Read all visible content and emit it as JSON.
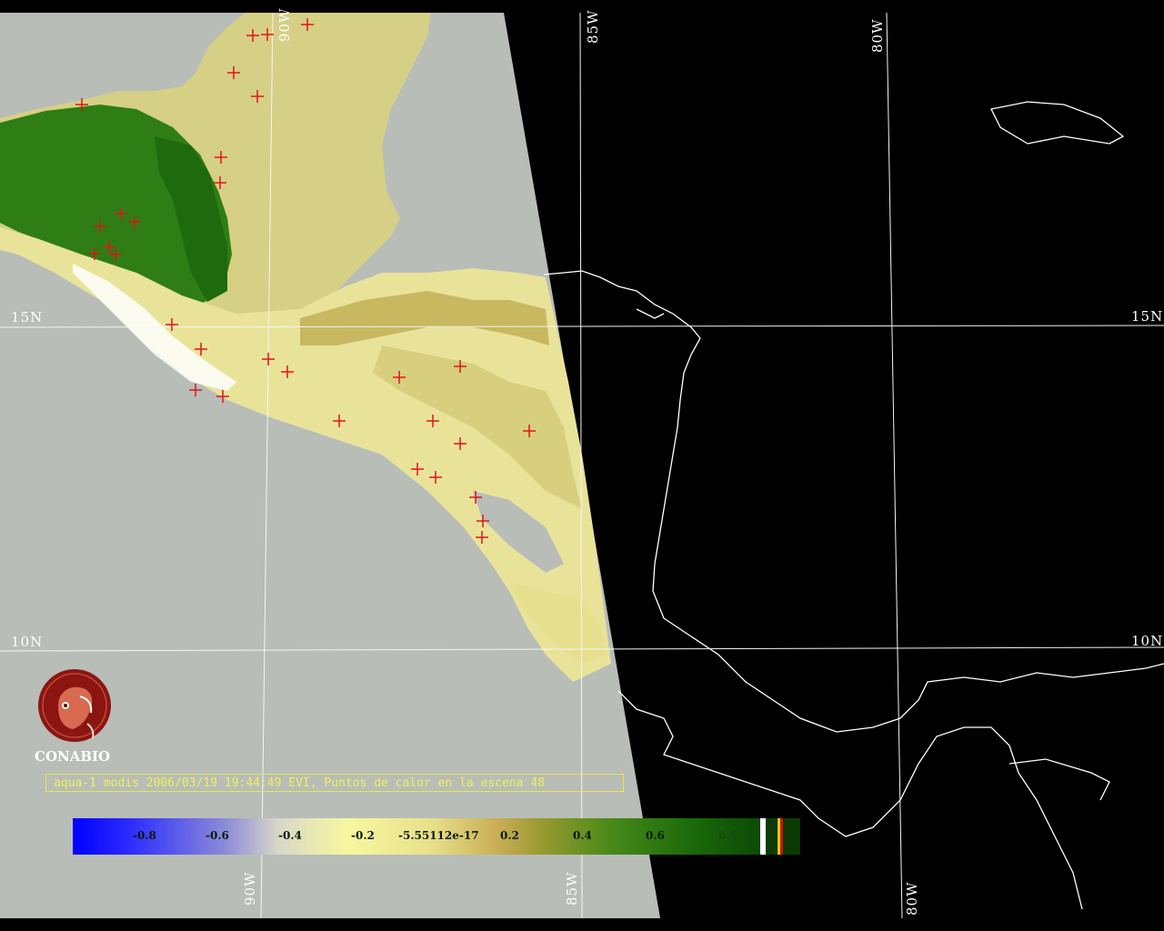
{
  "map": {
    "grid_labels": {
      "lat_15_left": "15N",
      "lat_15_right": "15N",
      "lat_10_left": "10N",
      "lat_10_right": "10N",
      "lon_90_top": "90W",
      "lon_85_top": "85W",
      "lon_80_top": "80W",
      "lon_90_bottom": "90W",
      "lon_85_bottom": "85W",
      "lon_80_bottom": "80W"
    },
    "hotspot_color": "#e0141a",
    "swath_background": "#b8bdb8",
    "vegetation_dense_color": "#2a7a12",
    "vegetation_sparse_color": "#e9e39a",
    "water_edge_color": "#6a78d8",
    "coastline_color": "#ffffff"
  },
  "logo": {
    "name": "CONABIO",
    "icon": "conabio-macaw-logo-icon",
    "color": "#8c1512"
  },
  "caption": {
    "text": "aqua-1 modis 2006/03/19 19:44:49 EVI, Puntos de calor en la escena 48",
    "color": "#f0f05a"
  },
  "colorbar": {
    "ticks": [
      "-0.8",
      "-0.6",
      "-0.4",
      "-0.2",
      "-5.55112e-17",
      "0.2",
      "0.4",
      "0.6",
      "0.8"
    ],
    "legend_swatches": [
      "#ffffff",
      "#0b3a05",
      "#e0c800",
      "#d01010"
    ]
  }
}
